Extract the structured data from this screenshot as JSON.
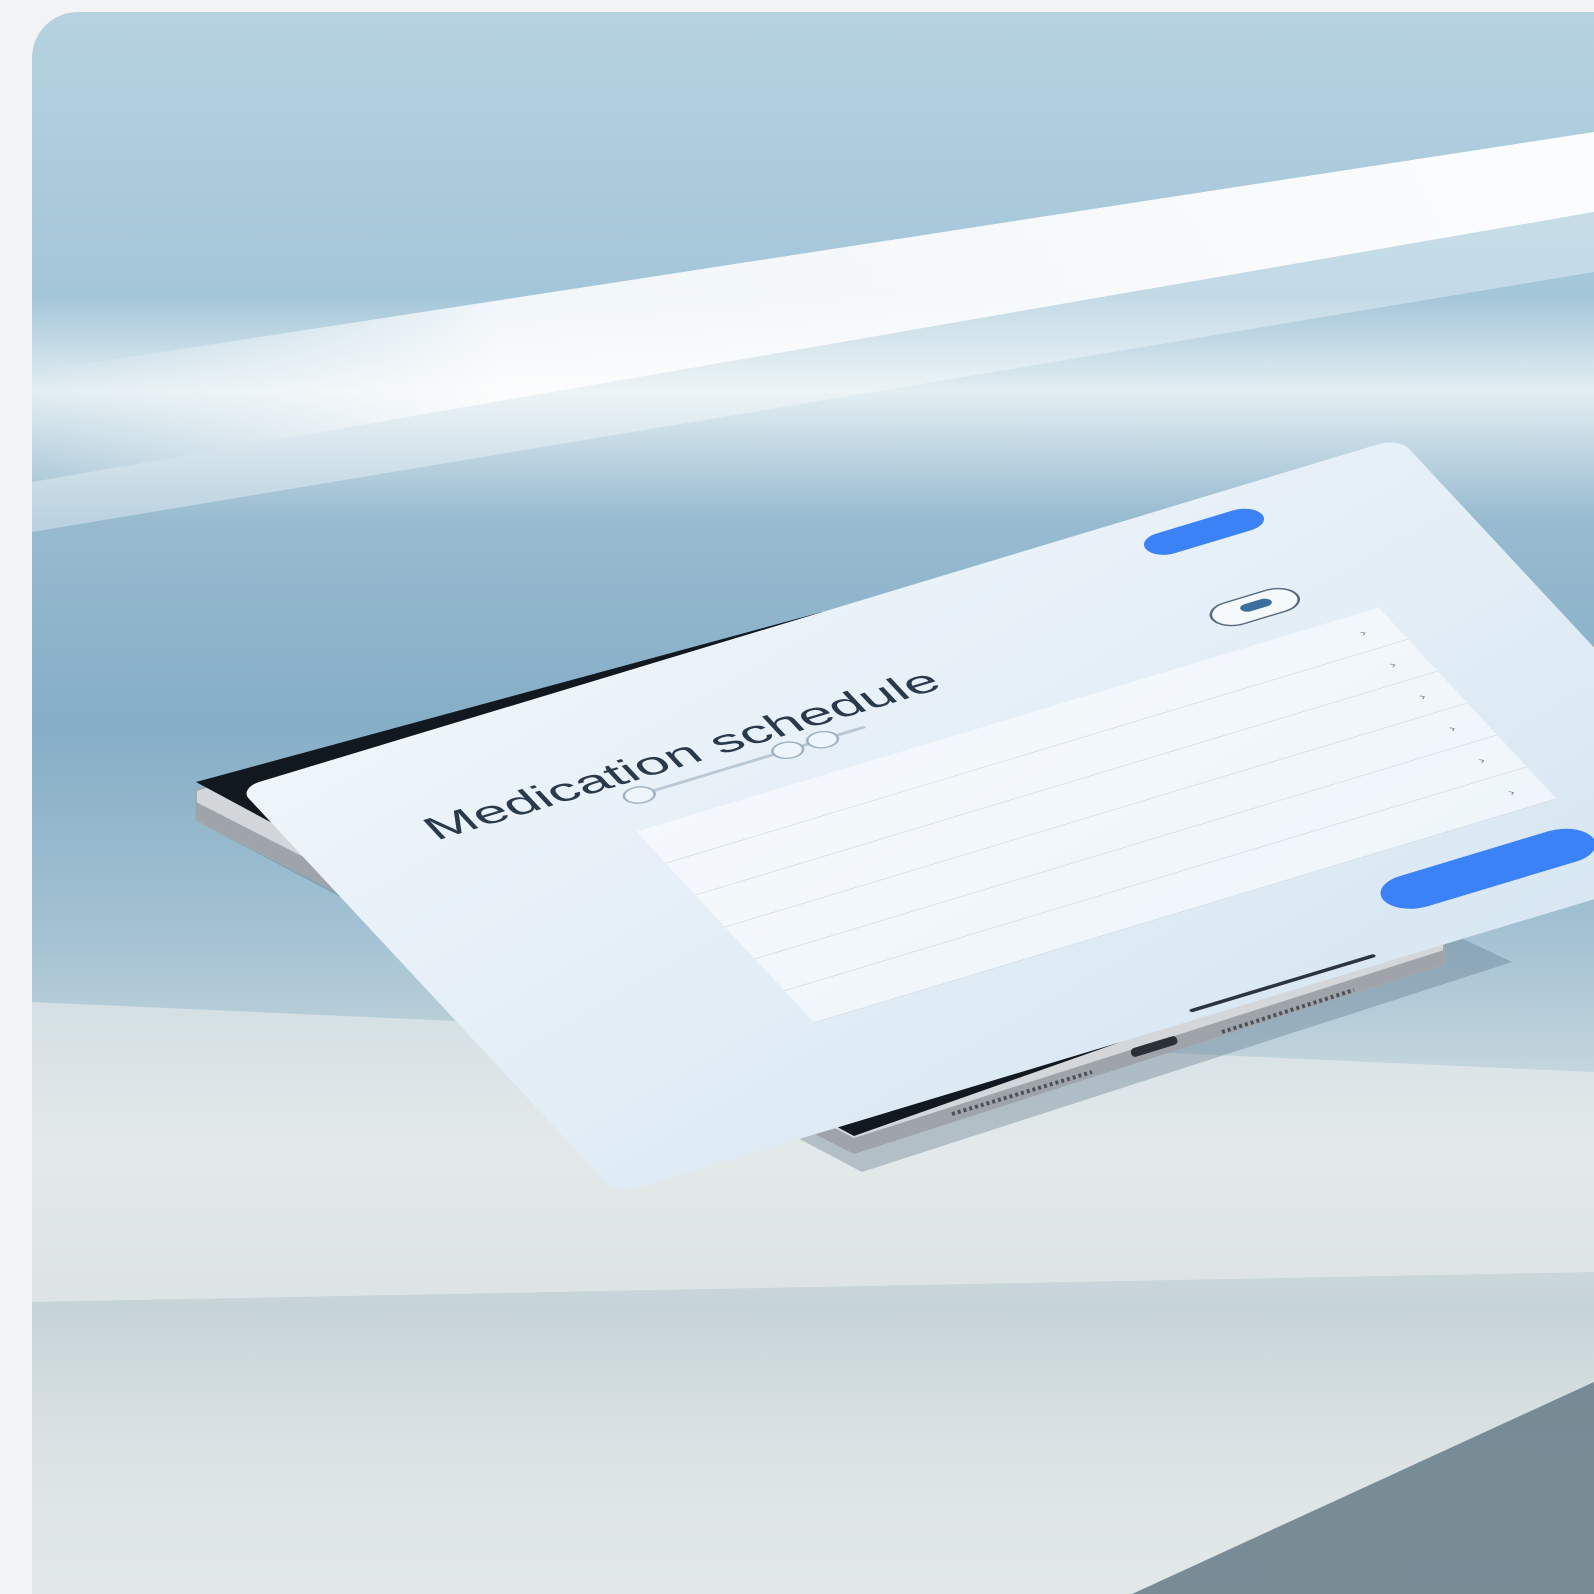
{
  "screen": {
    "title": "Medication schedule",
    "breadcrumb": "",
    "status_left": "",
    "subtitle": "",
    "top_button_label": "",
    "bottom_button_label": "",
    "list_items": [
      {
        "label": ""
      },
      {
        "label": ""
      },
      {
        "label": ""
      },
      {
        "label": ""
      },
      {
        "label": ""
      },
      {
        "label": ""
      }
    ]
  },
  "colors": {
    "accent": "#3b82f6",
    "pill": "#2e9fd8",
    "background": "#9fc0d4"
  }
}
